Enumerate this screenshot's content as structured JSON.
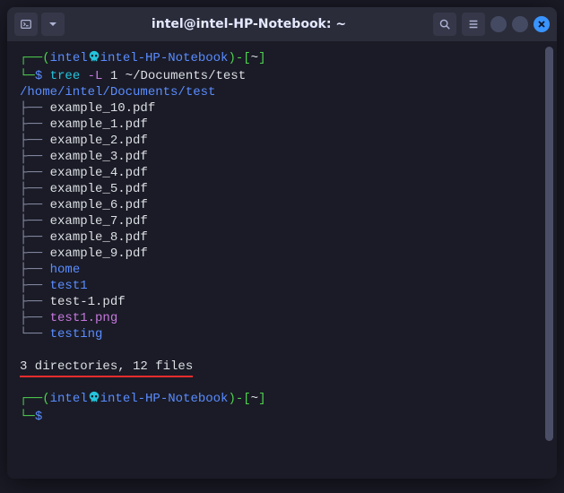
{
  "titlebar": {
    "title": "intel@intel-HP-Notebook: ~"
  },
  "prompt": {
    "user": "intel",
    "host": "intel-HP-Notebook",
    "cwd": "~",
    "symbol": "$"
  },
  "command": {
    "cmd": "tree",
    "flag": "-L",
    "level": "1",
    "arg": "~/Documents/test"
  },
  "tree": {
    "root": "/home/intel/Documents/test",
    "items": [
      {
        "name": "example_10.pdf",
        "type": "file"
      },
      {
        "name": "example_1.pdf",
        "type": "file"
      },
      {
        "name": "example_2.pdf",
        "type": "file"
      },
      {
        "name": "example_3.pdf",
        "type": "file"
      },
      {
        "name": "example_4.pdf",
        "type": "file"
      },
      {
        "name": "example_5.pdf",
        "type": "file"
      },
      {
        "name": "example_6.pdf",
        "type": "file"
      },
      {
        "name": "example_7.pdf",
        "type": "file"
      },
      {
        "name": "example_8.pdf",
        "type": "file"
      },
      {
        "name": "example_9.pdf",
        "type": "file"
      },
      {
        "name": "home",
        "type": "dir"
      },
      {
        "name": "test1",
        "type": "dir"
      },
      {
        "name": "test-1.pdf",
        "type": "file"
      },
      {
        "name": "test1.png",
        "type": "image"
      },
      {
        "name": "testing",
        "type": "dir"
      }
    ],
    "summary": "3 directories, 12 files"
  },
  "colors": {
    "bg": "#1a1b26",
    "fg": "#c0caf5",
    "green": "#4fd24f",
    "blue": "#5a8cff",
    "cyan": "#25c4dc",
    "magenta": "#c678dd"
  }
}
